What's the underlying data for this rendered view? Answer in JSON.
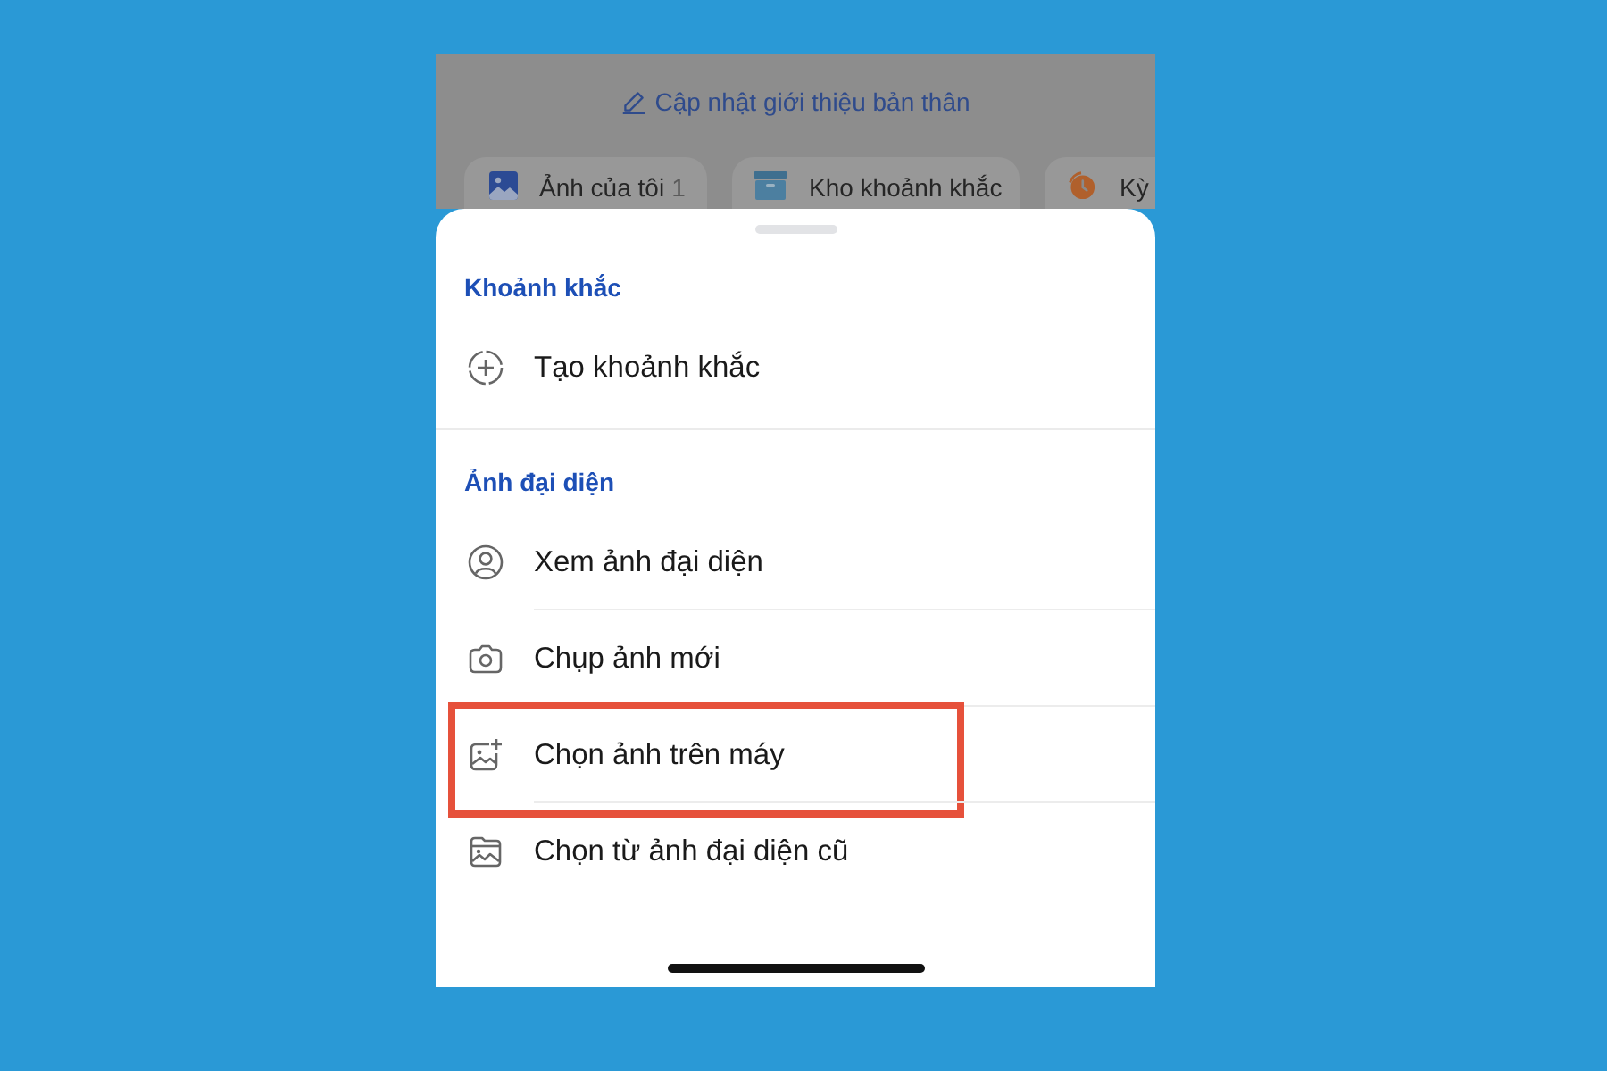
{
  "background_screen": {
    "edit_bio_link": "Cập nhật giới thiệu bản thân",
    "chips": [
      {
        "kind": "photos",
        "label": "Ảnh của tôi",
        "count": "1"
      },
      {
        "kind": "archive",
        "label": "Kho khoảnh khắc"
      },
      {
        "kind": "clock",
        "label": "Kỳ"
      }
    ]
  },
  "sheet": {
    "sections": [
      {
        "title": "Khoảnh khắc",
        "items": [
          {
            "kind": "create",
            "label": "Tạo khoảnh khắc",
            "highlighted": false
          }
        ]
      },
      {
        "title": "Ảnh đại diện",
        "items": [
          {
            "kind": "view",
            "label": "Xem ảnh đại diện",
            "highlighted": false
          },
          {
            "kind": "camera",
            "label": "Chụp ảnh mới",
            "highlighted": false
          },
          {
            "kind": "device",
            "label": "Chọn ảnh trên máy",
            "highlighted": true
          },
          {
            "kind": "old",
            "label": "Chọn từ ảnh đại diện cũ",
            "highlighted": false
          }
        ]
      }
    ]
  }
}
